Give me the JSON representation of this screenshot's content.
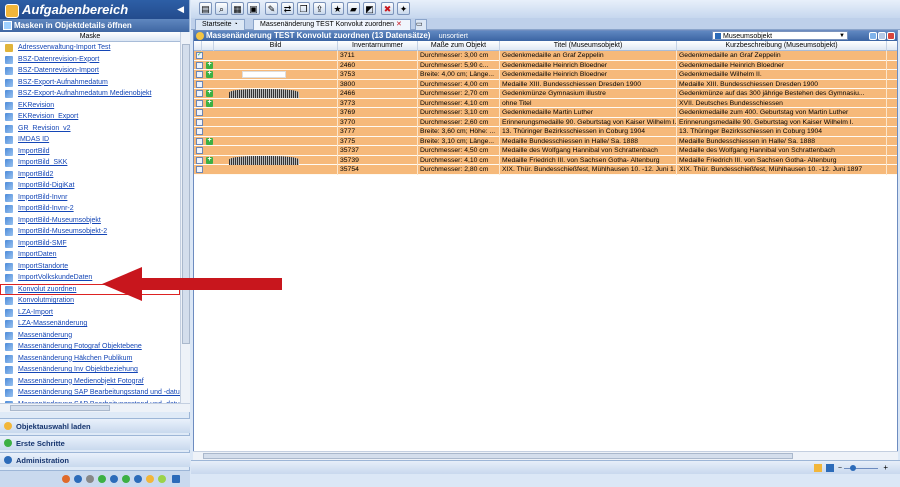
{
  "left": {
    "title": "Aufgabenbereich",
    "subtitle": "Masken in Objektdetails öffnen",
    "column_header": "Maske",
    "items": [
      {
        "label": "Adressverwaltung-Import Test",
        "icon": "key-icon"
      },
      {
        "label": "BSZ-Datenrevision-Export",
        "icon": "mask-icon"
      },
      {
        "label": "BSZ-Datenrevision-Import",
        "icon": "mask-icon"
      },
      {
        "label": "BSZ-Export-Aufnahmedatum",
        "icon": "mask-icon"
      },
      {
        "label": "BSZ-Export-Aufnahmedatum Medienobjekt",
        "icon": "mask-icon"
      },
      {
        "label": "EKRevision",
        "icon": "mask-icon"
      },
      {
        "label": "EKRevision_Export",
        "icon": "mask-icon"
      },
      {
        "label": "GR_Revision_v2",
        "icon": "mask-icon"
      },
      {
        "label": "IMDAS ID",
        "icon": "mask-icon"
      },
      {
        "label": "ImportBild",
        "icon": "mask-icon"
      },
      {
        "label": "ImportBild_SKK",
        "icon": "mask-icon"
      },
      {
        "label": "ImportBild2",
        "icon": "mask-icon"
      },
      {
        "label": "ImportBild-DigiKat",
        "icon": "mask-icon"
      },
      {
        "label": "ImportBild-Invnr",
        "icon": "mask-icon"
      },
      {
        "label": "ImportBild-Invnr-2",
        "icon": "mask-icon"
      },
      {
        "label": "ImportBild-Museumsobjekt",
        "icon": "mask-icon"
      },
      {
        "label": "ImportBild-Museumsobjekt-2",
        "icon": "mask-icon"
      },
      {
        "label": "ImportBild-SMF",
        "icon": "mask-icon"
      },
      {
        "label": "ImportDaten",
        "icon": "mask-icon"
      },
      {
        "label": "ImportStandorte",
        "icon": "mask-icon"
      },
      {
        "label": "ImportVolkskundeDaten",
        "icon": "mask-icon"
      },
      {
        "label": "Konvolut zuordnen",
        "icon": "mask-icon",
        "selected": true
      },
      {
        "label": "Konvolutmigration",
        "icon": "mask-icon"
      },
      {
        "label": "LZA-Import",
        "icon": "mask-icon"
      },
      {
        "label": "LZA-Massenänderung",
        "icon": "mask-icon"
      },
      {
        "label": "Massenänderung",
        "icon": "mask-icon"
      },
      {
        "label": "Massenänderung Fotograf Objektebene",
        "icon": "mask-icon"
      },
      {
        "label": "Massenänderung Häkchen Publikum",
        "icon": "mask-icon"
      },
      {
        "label": "Massenänderung Inv Objektbeziehung",
        "icon": "mask-icon"
      },
      {
        "label": "Massenänderung Medienobjekt Fotograf",
        "icon": "mask-icon"
      },
      {
        "label": "Massenänderung SAP Bearbeitungsstand und -datum",
        "icon": "mask-icon"
      },
      {
        "label": "Massenänderung SAP Bearbeitungsstand und -datum",
        "icon": "mask-icon"
      }
    ],
    "panels": [
      {
        "label": "Objektauswahl laden",
        "color": "#f2b63a"
      },
      {
        "label": "Erste Schritte",
        "color": "#3cb043"
      },
      {
        "label": "Administration",
        "color": "#2c6bb9"
      }
    ]
  },
  "tabs": [
    {
      "label": "Startseite",
      "active": false
    },
    {
      "label": "Massenänderung TEST Konvolut zuordnen",
      "active": true
    }
  ],
  "grid": {
    "title": "Massenänderung TEST Konvolut zuordnen (13 Datensätze)",
    "sort_status": "unsortiert",
    "object_select": "Museumsobjekt",
    "columns": [
      "Bild",
      "Inventarnummer",
      "Maße zum Objekt",
      "Titel (Museumsobjekt)",
      "Kurzbeschreibung (Museumsobjekt)"
    ],
    "rows": [
      {
        "inv": "3711",
        "masse": "Durchmesser: 3,00 cm",
        "titel": "Gedenkmedaille an Graf Zeppelin",
        "kurz": "Gedenkmedaille an Graf Zeppelin",
        "plus": false,
        "img": "none"
      },
      {
        "inv": "2460",
        "masse": "Durchmesser: 5,90 c...",
        "titel": "Gedenkmedaille Heinrich Bloedner",
        "kurz": "Gedenkmedaille Heinrich Bloedner",
        "plus": true,
        "img": "none"
      },
      {
        "inv": "3753",
        "masse": "Breite: 4,00 cm; Länge...",
        "titel": "Gedenkmedaille Heinrich Bloedner",
        "kurz": "Gedenkmedaille Wilhelm II.",
        "plus": true,
        "img": "white"
      },
      {
        "inv": "3800",
        "masse": "Durchmesser: 4,00 cm",
        "titel": "Medaille XIII. Bundesschiessen Dresden 1900",
        "kurz": "Medaille XIII. Bundesschiessen Dresden 1900",
        "plus": false,
        "img": "none"
      },
      {
        "inv": "2466",
        "masse": "Durchmesser: 2,70 cm",
        "titel": "Gedenkmünze Gymnasium illustre",
        "kurz": "Gedenkmünze auf das 300 jährige Bestehen des Gymnasiu...",
        "plus": true,
        "img": "coin"
      },
      {
        "inv": "3773",
        "masse": "Durchmesser: 4,10 cm",
        "titel": "ohne Titel",
        "kurz": "XVII. Deutsches Bundesschiessen",
        "plus": true,
        "img": "none"
      },
      {
        "inv": "3769",
        "masse": "Durchmesser: 3,10 cm",
        "titel": "Gedenkmedaille Martin Luther",
        "kurz": "Gedenkmedaille zum 400. Geburtstag von Martin Luther",
        "plus": false,
        "img": "none"
      },
      {
        "inv": "3770",
        "masse": "Durchmesser: 2,60 cm",
        "titel": "Erinnerungsmedaille 90. Geburtstag von Kaiser Wilhelm I.",
        "kurz": "Erinnerungsmedaille 90. Geburtstag von Kaiser Wilhelm I.",
        "plus": false,
        "img": "none"
      },
      {
        "inv": "3777",
        "masse": "Breite: 3,60 cm; Höhe: ...",
        "titel": "13. Thüringer Bezirksschiessen in Coburg 1904",
        "kurz": "13. Thüringer Bezirksschiessen in Coburg 1904",
        "plus": false,
        "img": "none"
      },
      {
        "inv": "3775",
        "masse": "Breite: 3,10 cm; Länge...",
        "titel": "Medaille Bundesschiessen in Halle/ Sa. 1888",
        "kurz": "Medaille Bundesschiessen in Halle/ Sa. 1888",
        "plus": true,
        "img": "none"
      },
      {
        "inv": "35737",
        "masse": "Durchmesser: 4,50 cm",
        "titel": "Medaille des Wolfgang Hannibal von Schrattenbach",
        "kurz": "Medaille des Wolfgang Hannibal von Schrattenbach",
        "plus": false,
        "img": "none"
      },
      {
        "inv": "35739",
        "masse": "Durchmesser: 4,10 cm",
        "titel": "Medaille Friedrich III. von Sachsen Gotha- Altenburg",
        "kurz": "Medaille Friedrich III. von Sachsen Gotha- Altenburg",
        "plus": true,
        "img": "coin"
      },
      {
        "inv": "35754",
        "masse": "Durchmesser: 2,80 cm",
        "titel": "XIX. Thür. Bundesschießfest, Mühlhausen 10. -12. Juni 1...",
        "kurz": "XIX. Thür. Bundesschießfest, Mühlhausen 10. -12. Juni 1897",
        "plus": false,
        "img": "none"
      }
    ]
  },
  "colors": {
    "row_bg": "#f6b97a",
    "header_blue": "#3b64a3",
    "arrow_red": "#c8161d"
  }
}
